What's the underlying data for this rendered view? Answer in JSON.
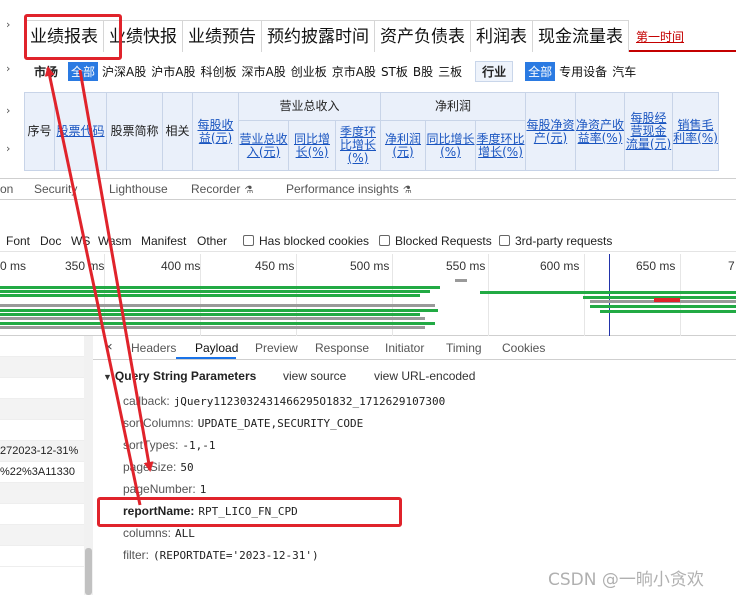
{
  "webpage": {
    "tabs": [
      "业绩报表",
      "业绩快报",
      "业绩预告",
      "预约披露时间",
      "资产负债表",
      "利润表",
      "现金流量表"
    ],
    "active_tab": "业绩报表",
    "more_link": "第一时间",
    "market_label": "市场",
    "market_active": "全部",
    "markets": [
      "沪深A股",
      "沪市A股",
      "科创板",
      "深市A股",
      "创业板",
      "京市A股",
      "ST板",
      "B股",
      "三板"
    ],
    "industry_label": "行业",
    "industry_active": "全部",
    "industries": [
      "专用设备",
      "汽车"
    ],
    "table": {
      "seq": "序号",
      "stock_code": "股票代码",
      "stock_name": "股票简称",
      "related": "相关",
      "eps": "每股收益(元)",
      "revenue_group": "营业总收入",
      "revenue": "营业总收入(元)",
      "revenue_yoy": "同比增长(%)",
      "revenue_qoq": "季度环比增长(%)",
      "profit_group": "净利润",
      "profit": "净利润(元)",
      "profit_yoy": "同比增长(%)",
      "profit_qoq": "季度环比增长(%)",
      "bvps": "每股净资产(元)",
      "roe": "净资产收益率(%)",
      "cfps": "每股经营现金流量(元)",
      "gross_margin": "销售毛利率(%)"
    }
  },
  "devtools": {
    "panel_tabs": [
      "on",
      "Security",
      "Lighthouse",
      "Recorder",
      "Performance insights"
    ],
    "filters": [
      "Font",
      "Doc",
      "WS",
      "Wasm",
      "Manifest",
      "Other"
    ],
    "checkboxes": [
      "Has blocked cookies",
      "Blocked Requests",
      "3rd-party requests"
    ],
    "timeline_labels": [
      "0 ms",
      "350 ms",
      "400 ms",
      "450 ms",
      "500 ms",
      "550 ms",
      "600 ms",
      "650 ms",
      "7"
    ],
    "request_rows": [
      "",
      "",
      "",
      "",
      "",
      "272023-12-31%",
      "%22%3A11330",
      "",
      "",
      "",
      ""
    ],
    "detail_tabs": [
      "Headers",
      "Payload",
      "Preview",
      "Response",
      "Initiator",
      "Timing",
      "Cookies"
    ],
    "active_detail_tab": "Payload",
    "close": "×",
    "query_string_title": "Query String Parameters",
    "view_source": "view source",
    "view_url_encoded": "view URL-encoded",
    "params": [
      {
        "key": "callback:",
        "value": "jQuery1123032431466295O1832_1712629107300"
      },
      {
        "key": "sortColumns:",
        "value": "UPDATE_DATE,SECURITY_CODE"
      },
      {
        "key": "sortTypes:",
        "value": "-1,-1"
      },
      {
        "key": "pageSize:",
        "value": "50"
      },
      {
        "key": "pageNumber:",
        "value": "1"
      },
      {
        "key": "reportName:",
        "value": "RPT_LICO_FN_CPD"
      },
      {
        "key": "columns:",
        "value": "ALL"
      },
      {
        "key": "filter:",
        "value": "(REPORTDATE='2023-12-31')"
      }
    ]
  },
  "watermark": "CSDN @一晌小贪欢",
  "colors": {
    "annotation": "#e0232b",
    "bars_green": "#22aa44",
    "bars_gray": "#9a9a9a",
    "accent_blue": "#1a73e8"
  }
}
